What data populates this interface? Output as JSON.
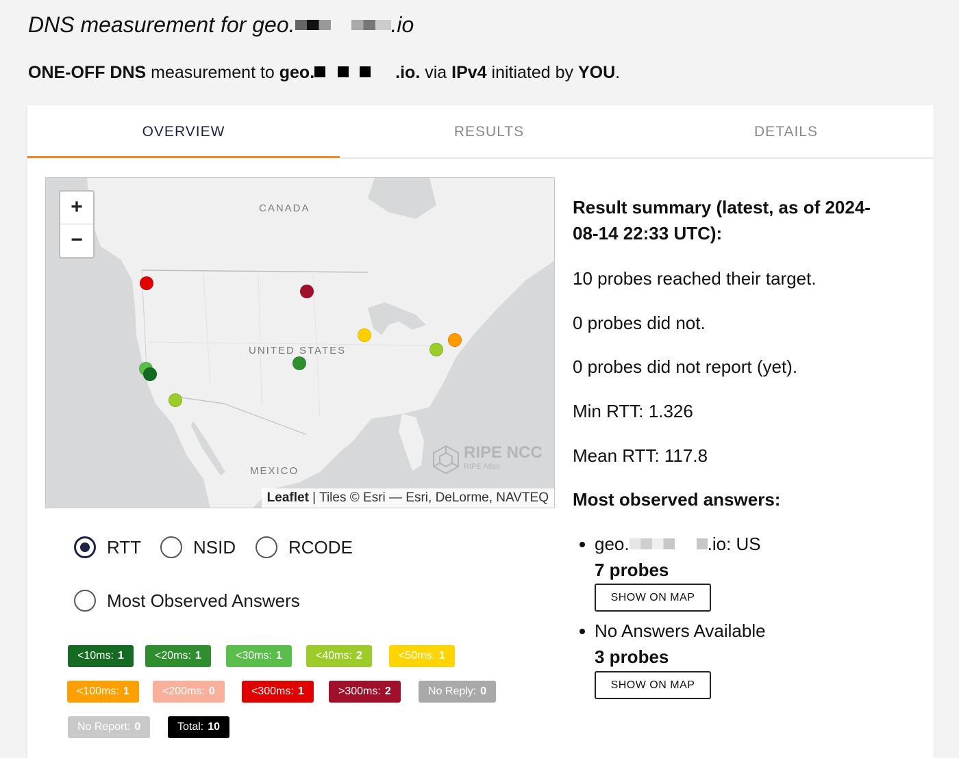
{
  "header": {
    "title_prefix": "DNS measurement for geo.",
    "title_suffix": ".io",
    "subtitle": {
      "type": "ONE-OFF DNS",
      "t1": " measurement to ",
      "target_prefix": "geo.",
      "target_suffix": ".io.",
      "t2": " via ",
      "protocol": "IPv4",
      "t3": " initiated by ",
      "initiator": "YOU",
      "t4": "."
    }
  },
  "tabs": [
    {
      "label": "OVERVIEW",
      "active": true
    },
    {
      "label": "RESULTS",
      "active": false
    },
    {
      "label": "DETAILS",
      "active": false
    }
  ],
  "map": {
    "zoom_in": "+",
    "zoom_out": "−",
    "labels": {
      "canada": "CANADA",
      "us": "UNITED STATES",
      "mexico": "MEXICO"
    },
    "attribution_link": "Leaflet",
    "attribution_text": " | Tiles © Esri — Esri, DeLorme, NAVTEQ",
    "logo_title": "RIPE NCC",
    "logo_sub": "RIPE Atlas",
    "probe_colors": [
      "#e00000",
      "#a0102a",
      "#ffd000",
      "#ff9a00",
      "#9ccc2a",
      "#2f8f2f",
      "#5abe4a",
      "#156b22",
      "#9ccc2a"
    ]
  },
  "view_options": {
    "rtt": "RTT",
    "nsid": "NSID",
    "rcode": "RCODE",
    "most_observed": "Most Observed Answers",
    "selected": "RTT"
  },
  "legend": [
    {
      "label": "<10ms:",
      "count": "1",
      "color": "#156b22"
    },
    {
      "label": "<20ms:",
      "count": "1",
      "color": "#2f8f2f"
    },
    {
      "label": "<30ms:",
      "count": "1",
      "color": "#5abe4a"
    },
    {
      "label": "<40ms:",
      "count": "2",
      "color": "#9ccc2a"
    },
    {
      "label": "<50ms:",
      "count": "1",
      "color": "#ffd500"
    },
    {
      "label": "<100ms:",
      "count": "1",
      "color": "#ffa000"
    },
    {
      "label": "<200ms:",
      "count": "0",
      "color": "#f8b09a"
    },
    {
      "label": "<300ms:",
      "count": "1",
      "color": "#e00000"
    },
    {
      "label": ">300ms:",
      "count": "2",
      "color": "#a0102a"
    },
    {
      "label": "No Reply:",
      "count": "0",
      "color": "#a9a9a9"
    },
    {
      "label": "No Report:",
      "count": "0",
      "color": "#c9c9c9"
    },
    {
      "label": "Total:",
      "count": "10",
      "color": "#000000"
    }
  ],
  "summary": {
    "heading": "Result summary (latest, as of 2024-08-14 22:33 UTC):",
    "reached": "10 probes reached their target.",
    "not_reached": "0 probes did not.",
    "not_reported": "0 probes did not report (yet).",
    "min_rtt": "Min RTT: 1.326",
    "mean_rtt": "Mean RTT: 117.8",
    "answers_heading": "Most observed answers:",
    "answers": [
      {
        "prefix": "geo.",
        "suffix": ".io: US",
        "count": "7 probes",
        "button": "SHOW ON MAP"
      },
      {
        "label": "No Answers Available",
        "count": "3 probes",
        "button": "SHOW ON MAP"
      }
    ]
  }
}
